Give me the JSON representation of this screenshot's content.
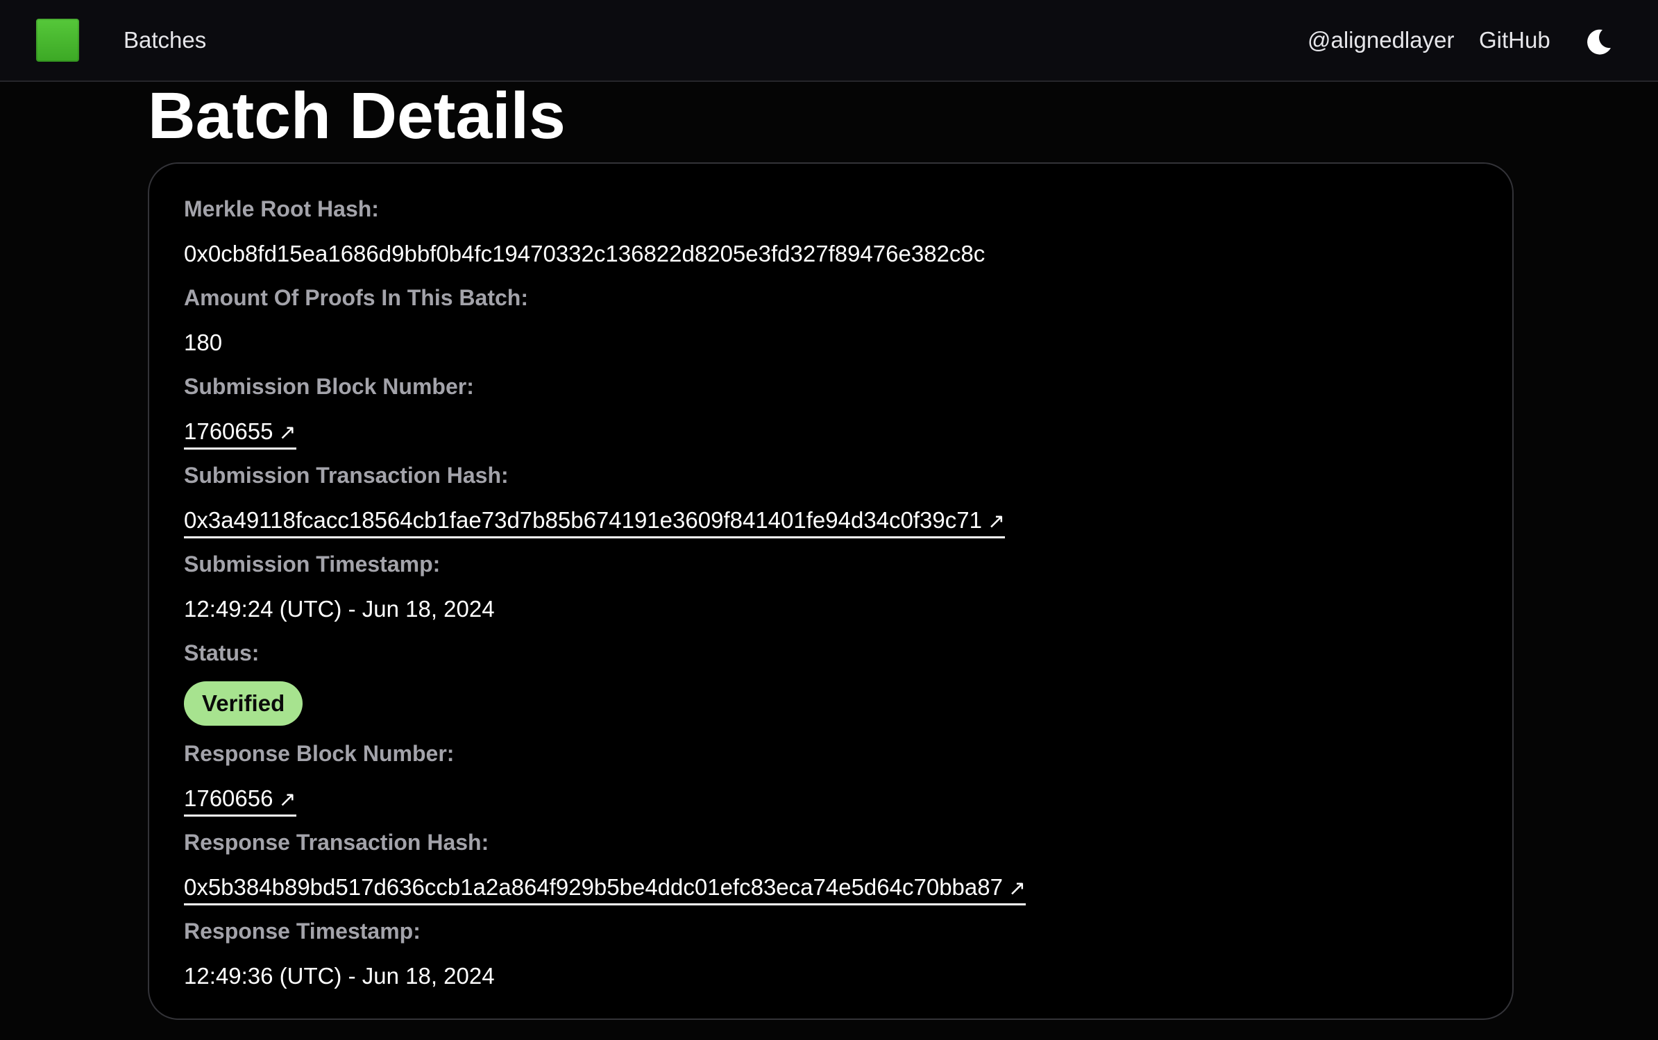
{
  "nav": {
    "batches_label": "Batches",
    "twitter_label": "@alignedlayer",
    "github_label": "GitHub",
    "logo_color": "#4cbf31"
  },
  "page": {
    "title": "Batch Details"
  },
  "details": {
    "merkle_root_label": "Merkle Root Hash:",
    "merkle_root_value": "0x0cb8fd15ea1686d9bbf0b4fc19470332c136822d8205e3fd327f89476e382c8c",
    "amount_label": "Amount Of Proofs In This Batch:",
    "amount_value": "180",
    "submission_block_label": "Submission Block Number:",
    "submission_block_value": "1760655",
    "submission_tx_label": "Submission Transaction Hash:",
    "submission_tx_value": "0x3a49118fcacc18564cb1fae73d7b85b674191e3609f841401fe94d34c0f39c71",
    "submission_timestamp_label": "Submission Timestamp:",
    "submission_timestamp_value": "12:49:24 (UTC) - Jun 18, 2024",
    "status_label": "Status:",
    "status_value": "Verified",
    "status_color": "#a7e38f",
    "response_block_label": "Response Block Number:",
    "response_block_value": "1760656",
    "response_tx_label": "Response Transaction Hash:",
    "response_tx_value": "0x5b384b89bd517d636ccb1a2a864f929b5be4ddc01efc83eca74e5d64c70bba87",
    "response_timestamp_label": "Response Timestamp:",
    "response_timestamp_value": "12:49:36 (UTC) - Jun 18, 2024"
  },
  "icons": {
    "external_link": "external-link-icon",
    "theme": "moon-icon"
  }
}
